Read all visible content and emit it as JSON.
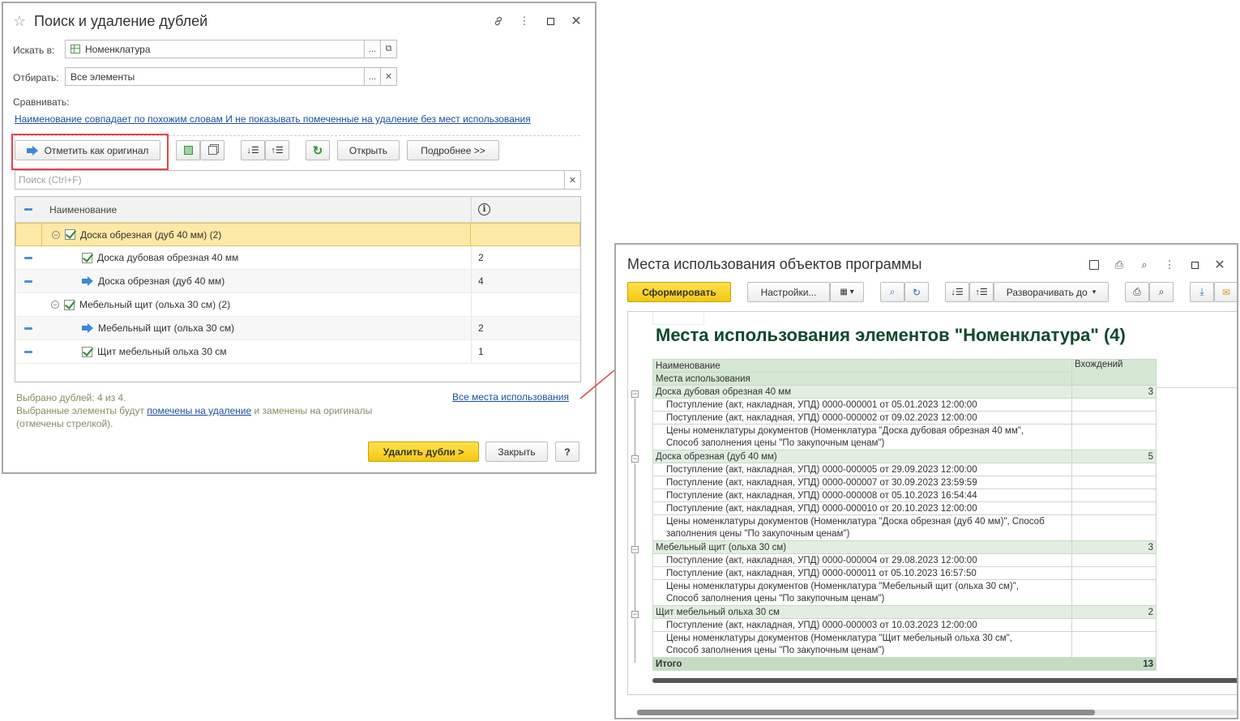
{
  "dialog": {
    "title": "Поиск и удаление дублей",
    "search_in_label": "Искать в:",
    "search_in_value": "Номенклатура",
    "filter_label": "Отбирать:",
    "filter_value": "Все элементы",
    "compare_label": "Сравнивать:",
    "compare_link": "Наименование совпадает по похожим словам И не показывать помеченные на удаление без мест использования",
    "toolbar": {
      "mark_original": "Отметить как оригинал",
      "open": "Открыть",
      "details": "Подробнее >>"
    },
    "search_placeholder": "Поиск (Ctrl+F)",
    "grid": {
      "col_name": "Наименование",
      "rows": [
        {
          "name": "Доска обрезная (дуб 40 мм) (2)",
          "value": ""
        },
        {
          "name": "Доска дубовая обрезная 40 мм",
          "value": "2"
        },
        {
          "name": "Доска обрезная (дуб 40 мм)",
          "value": "4"
        },
        {
          "name": "Мебельный щит (ольха 30 см) (2)",
          "value": ""
        },
        {
          "name": "Мебельный щит (ольха 30 см)",
          "value": "2"
        },
        {
          "name": "Щит мебельный ольха 30  см",
          "value": "1"
        }
      ]
    },
    "footer": {
      "selected": "Выбрано дублей: 4 из 4.",
      "note_pre": "Выбранные элементы будут ",
      "note_link": "помечены на удаление",
      "note_post": " и заменены на оригиналы",
      "note_line2": "(отмечены стрелкой).",
      "all_places": "Все места использования"
    },
    "buttons": {
      "delete": "Удалить дубли >",
      "close": "Закрыть",
      "help": "?"
    }
  },
  "report_window": {
    "title": "Места использования объектов программы",
    "toolbar": {
      "generate": "Сформировать",
      "settings": "Настройки...",
      "expand": "Разворачивать до"
    },
    "report": {
      "title": "Места использования элементов \"Номенклатура\" (4)",
      "header_name": "Наименование",
      "header_places": "Места использования",
      "header_count": "Вхождений",
      "groups": [
        {
          "name": "Доска дубовая обрезная 40 мм",
          "count": "3",
          "items": [
            {
              "l1": "Поступление (акт, накладная, УПД) 0000-000001 от 05.01.2023 12:00:00"
            },
            {
              "l1": "Поступление (акт, накладная, УПД) 0000-000002 от 09.02.2023 12:00:00"
            },
            {
              "l1": "Цены номенклатуры документов (Номенклатура \"Доска дубовая обрезная 40 мм\",",
              "l2": "Способ заполнения цены \"По закупочным ценам\")"
            }
          ]
        },
        {
          "name": "Доска обрезная (дуб 40 мм)",
          "count": "5",
          "items": [
            {
              "l1": "Поступление (акт, накладная, УПД) 0000-000005 от 29.09.2023 12:00:00"
            },
            {
              "l1": "Поступление (акт, накладная, УПД) 0000-000007 от 30.09.2023 23:59:59"
            },
            {
              "l1": "Поступление (акт, накладная, УПД) 0000-000008 от 05.10.2023 16:54:44"
            },
            {
              "l1": "Поступление (акт, накладная, УПД) 0000-000010 от 20.10.2023 12:00:00"
            },
            {
              "l1": "Цены номенклатуры документов (Номенклатура \"Доска обрезная (дуб 40 мм)\", Способ",
              "l2": "заполнения цены \"По закупочным ценам\")"
            }
          ]
        },
        {
          "name": "Мебельный щит (ольха 30 см)",
          "count": "3",
          "items": [
            {
              "l1": "Поступление (акт, накладная, УПД) 0000-000004 от 29.08.2023 12:00:00"
            },
            {
              "l1": "Поступление (акт, накладная, УПД) 0000-000011 от 05.10.2023 16:57:50"
            },
            {
              "l1": "Цены номенклатуры документов (Номенклатура \"Мебельный щит (ольха 30 см)\",",
              "l2": "Способ заполнения цены \"По закупочным ценам\")"
            }
          ]
        },
        {
          "name": "Щит мебельный ольха 30  см",
          "count": "2",
          "items": [
            {
              "l1": "Поступление (акт, накладная, УПД) 0000-000003 от 10.03.2023 12:00:00"
            },
            {
              "l1": "Цены номенклатуры документов (Номенклатура \"Щит мебельный ольха 30  см\",",
              "l2": "Способ заполнения цены \"По закупочным ценам\")"
            }
          ]
        }
      ],
      "total_label": "Итого",
      "total_value": "13"
    }
  },
  "colors": {
    "highlight_box": "#e0454b",
    "primary_button": "#f5cd1c",
    "selected_row": "#fde9a6",
    "report_title": "#0e4a2e",
    "report_group": "#e2efe0"
  }
}
